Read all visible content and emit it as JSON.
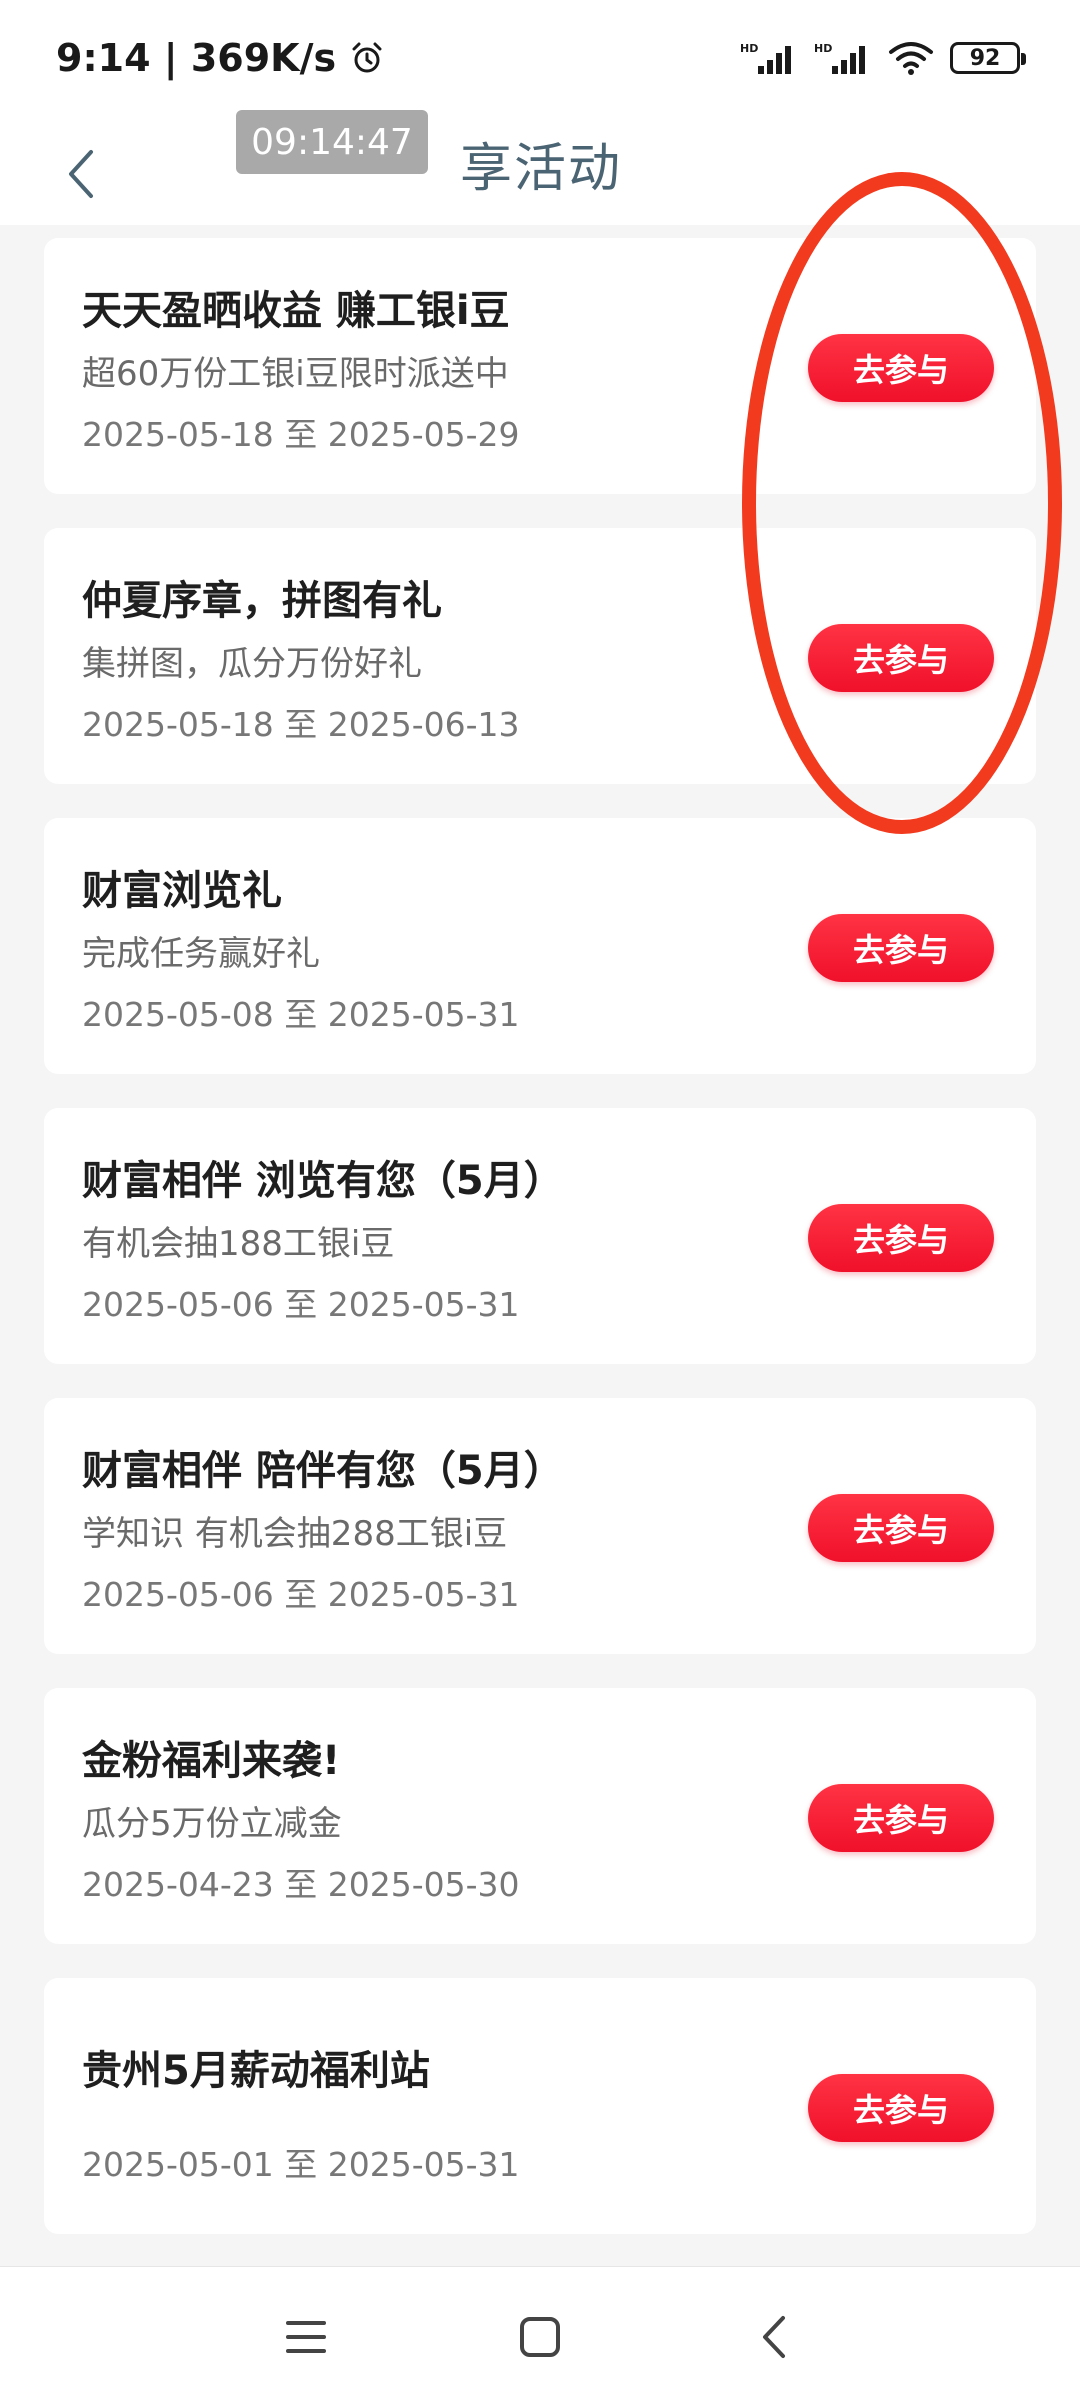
{
  "status_bar": {
    "time_speed": "9:14 | 369K/s",
    "battery": "92",
    "icons": [
      "alarm-icon",
      "signal-icon",
      "signal-icon",
      "wifi-icon",
      "battery-icon"
    ]
  },
  "header": {
    "clock": "09:14:47",
    "title": "享活动"
  },
  "activities": [
    {
      "title": "天天盈晒收益 赚工银i豆",
      "subtitle": "超60万份工银i豆限时派送中",
      "date": "2025-05-18 至 2025-05-29",
      "button": "去参与"
    },
    {
      "title": "仲夏序章，拼图有礼",
      "subtitle": "集拼图，瓜分万份好礼",
      "date": "2025-05-18 至 2025-06-13",
      "button": "去参与"
    },
    {
      "title": "财富浏览礼",
      "subtitle": "完成任务赢好礼",
      "date": "2025-05-08 至 2025-05-31",
      "button": "去参与"
    },
    {
      "title": "财富相伴 浏览有您（5月）",
      "subtitle": "有机会抽188工银i豆",
      "date": "2025-05-06 至 2025-05-31",
      "button": "去参与"
    },
    {
      "title": "财富相伴 陪伴有您（5月）",
      "subtitle": "学知识 有机会抽288工银i豆",
      "date": "2025-05-06 至 2025-05-31",
      "button": "去参与"
    },
    {
      "title": "金粉福利来袭!",
      "subtitle": "瓜分5万份立减金",
      "date": "2025-04-23 至 2025-05-30",
      "button": "去参与"
    },
    {
      "title": "贵州5月薪动福利站",
      "subtitle": "",
      "date": "2025-05-01 至 2025-05-31",
      "button": "去参与"
    }
  ],
  "colors": {
    "accent": "#f0102a",
    "annotation": "#f23a1e",
    "title": "#4b6473"
  }
}
